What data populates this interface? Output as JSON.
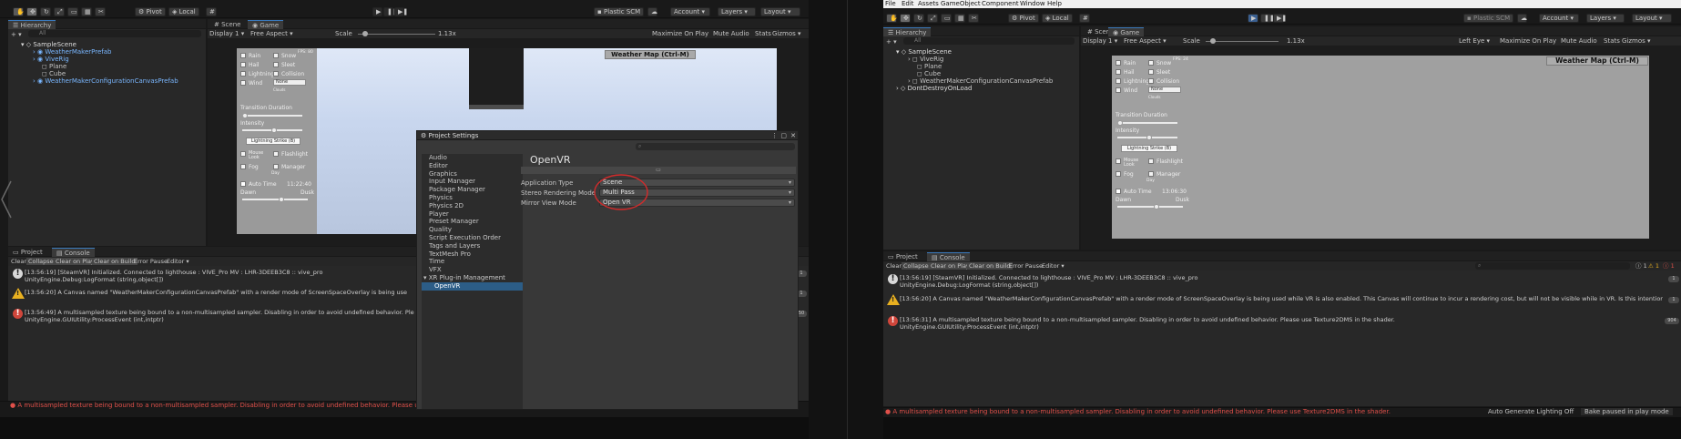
{
  "left": {
    "toolbar": {
      "pivot": "Pivot",
      "local": "Local",
      "plastic": "Plastic SCM",
      "account": "Account",
      "layers": "Layers",
      "layout": "Layout"
    },
    "hierarchy": {
      "tab": "Hierarchy",
      "search_placeholder": "All",
      "scene": "SampleScene",
      "items": [
        "WeatherMakerPrefab",
        "ViveRig",
        "Plane",
        "Cube",
        "WeatherMakerConfigurationCanvasPrefab"
      ]
    },
    "game": {
      "tabs": [
        "Scene",
        "Game"
      ],
      "display": "Display 1",
      "aspect": "Free Aspect",
      "scale_label": "Scale",
      "scale_value": "1.13x",
      "options": [
        "Maximize On Play",
        "Mute Audio",
        "Stats",
        "Gizmos"
      ],
      "weather_title": "Weather Map (Ctrl-M)",
      "fps": "FPS: 80",
      "checks": [
        "Rain",
        "Snow",
        "Hail",
        "Sleet",
        "Lightning",
        "Collision",
        "Wind"
      ],
      "dropdown": "None",
      "clouds": "Clouds",
      "transition": "Transition Duration",
      "intensity": "Intensity",
      "lightning_btn": "Lightning Strike (B)",
      "mouse_look": "Mouse Look",
      "flashlight": "Flashlight",
      "fog": "Fog",
      "manager": "Manager",
      "day": "Day",
      "auto_time": "Auto Time",
      "time": "11:22:40",
      "dawn": "Dawn",
      "dusk": "Dusk"
    },
    "console": {
      "tabs": [
        "Project",
        "Console"
      ],
      "tools": [
        "Clear",
        "Collapse",
        "Clear on Play",
        "Clear on Build",
        "Error Pause",
        "Editor"
      ],
      "logs": [
        {
          "type": "info",
          "line1": "[13:56:19] [SteamVR] Initialized. Connected to lighthouse : VIVE_Pro MV : LHR-3DEEB3C8 :: vive_pro",
          "line2": "UnityEngine.Debug:LogFormat (string,object[])"
        },
        {
          "type": "warn",
          "line1": "[13:56:20] A Canvas named \"WeatherMakerConfigurationCanvasPrefab\" with a render mode of ScreenSpaceOverlay is being use",
          "line2": ""
        },
        {
          "type": "error",
          "line1": "[13:56:49] A multisampled texture being bound to a non-multisampled sampler. Disabling in order to avoid undefined behavior. Ple",
          "line2": "UnityEngine.GUIUtility:ProcessEvent (int,intptr)"
        }
      ],
      "counts": [
        "1",
        "1",
        "50"
      ],
      "status": "A multisampled texture being bound to a non-multisampled sampler. Disabling in order to avoid undefined behavior. Please use Textu"
    },
    "project_settings": {
      "title": "Project Settings",
      "list": [
        "Audio",
        "Editor",
        "Graphics",
        "Input Manager",
        "Package Manager",
        "Physics",
        "Physics 2D",
        "Player",
        "Preset Manager",
        "Quality",
        "Script Execution Order",
        "Tags and Layers",
        "TextMesh Pro",
        "Time",
        "VFX",
        "XR Plug-in Management",
        "OpenVR"
      ],
      "header": "OpenVR",
      "fields": [
        {
          "label": "Application Type",
          "value": "Scene"
        },
        {
          "label": "Stereo Rendering Mode",
          "value": "Multi Pass"
        },
        {
          "label": "Mirror View Mode",
          "value": "Open VR"
        }
      ]
    }
  },
  "right": {
    "menu": [
      "File",
      "Edit",
      "Assets",
      "GameObject",
      "Component",
      "Window",
      "Help"
    ],
    "toolbar": {
      "pivot": "Pivot",
      "local": "Local",
      "plastic": "Plastic SCM",
      "account": "Account",
      "layers": "Layers",
      "layout": "Layout"
    },
    "hierarchy": {
      "tab": "Hierarchy",
      "search_placeholder": "All",
      "scene": "SampleScene",
      "items": [
        "ViveRig",
        "Plane",
        "Cube",
        "WeatherMakerConfigurationCanvasPrefab"
      ],
      "dont_destroy": "DontDestroyOnLoad"
    },
    "game": {
      "tabs": [
        "Scene",
        "Game"
      ],
      "display": "Display 1",
      "aspect": "Free Aspect",
      "scale_label": "Scale",
      "scale_value": "1.13x",
      "options": [
        "Left Eye",
        "Maximize On Play",
        "Mute Audio",
        "Stats",
        "Gizmos"
      ],
      "weather_title": "Weather Map (Ctrl-M)",
      "fps": "FPS: 24",
      "checks": [
        "Rain",
        "Snow",
        "Hail",
        "Sleet",
        "Lightning",
        "Collision",
        "Wind"
      ],
      "dropdown": "None",
      "clouds": "Clouds",
      "transition": "Transition Duration",
      "intensity": "Intensity",
      "lightning_btn": "Lightning Strike (B)",
      "mouse_look": "Mouse Look",
      "flashlight": "Flashlight",
      "fog": "Fog",
      "manager": "Manager",
      "day": "Day",
      "auto_time": "Auto Time",
      "time": "13:06:30",
      "dawn": "Dawn",
      "dusk": "Dusk"
    },
    "console": {
      "tabs": [
        "Project",
        "Console"
      ],
      "tools": [
        "Clear",
        "Collapse",
        "Clear on Play",
        "Clear on Build",
        "Error Pause",
        "Editor"
      ],
      "badges": [
        "1",
        "1",
        "1"
      ],
      "logs": [
        {
          "type": "info",
          "line1": "[13:56:19] [SteamVR] Initialized. Connected to lighthouse : VIVE_Pro MV : LHR-3DEEB3C8 :: vive_pro",
          "line2": "UnityEngine.Debug:LogFormat (string,object[])"
        },
        {
          "type": "warn",
          "line1": "[13:56:20] A Canvas named \"WeatherMakerConfigurationCanvasPrefab\" with a render mode of ScreenSpaceOverlay is being used while VR is also enabled. This Canvas will continue to incur a rendering cost, but will not be visible while in VR. Is this intentional?",
          "line2": ""
        },
        {
          "type": "error",
          "line1": "[13:56:31] A multisampled texture being bound to a non-multisampled sampler. Disabling in order to avoid undefined behavior. Please use Texture2DMS in the shader.",
          "line2": "UnityEngine.GUIUtility:ProcessEvent (int,intptr)"
        }
      ],
      "counts": [
        "1",
        "1",
        "904"
      ],
      "status": "A multisampled texture being bound to a non-multisampled sampler. Disabling in order to avoid undefined behavior. Please use Texture2DMS in the shader.",
      "auto_lighting": "Auto Generate Lighting Off",
      "bake_paused": "Bake paused in play mode"
    }
  }
}
